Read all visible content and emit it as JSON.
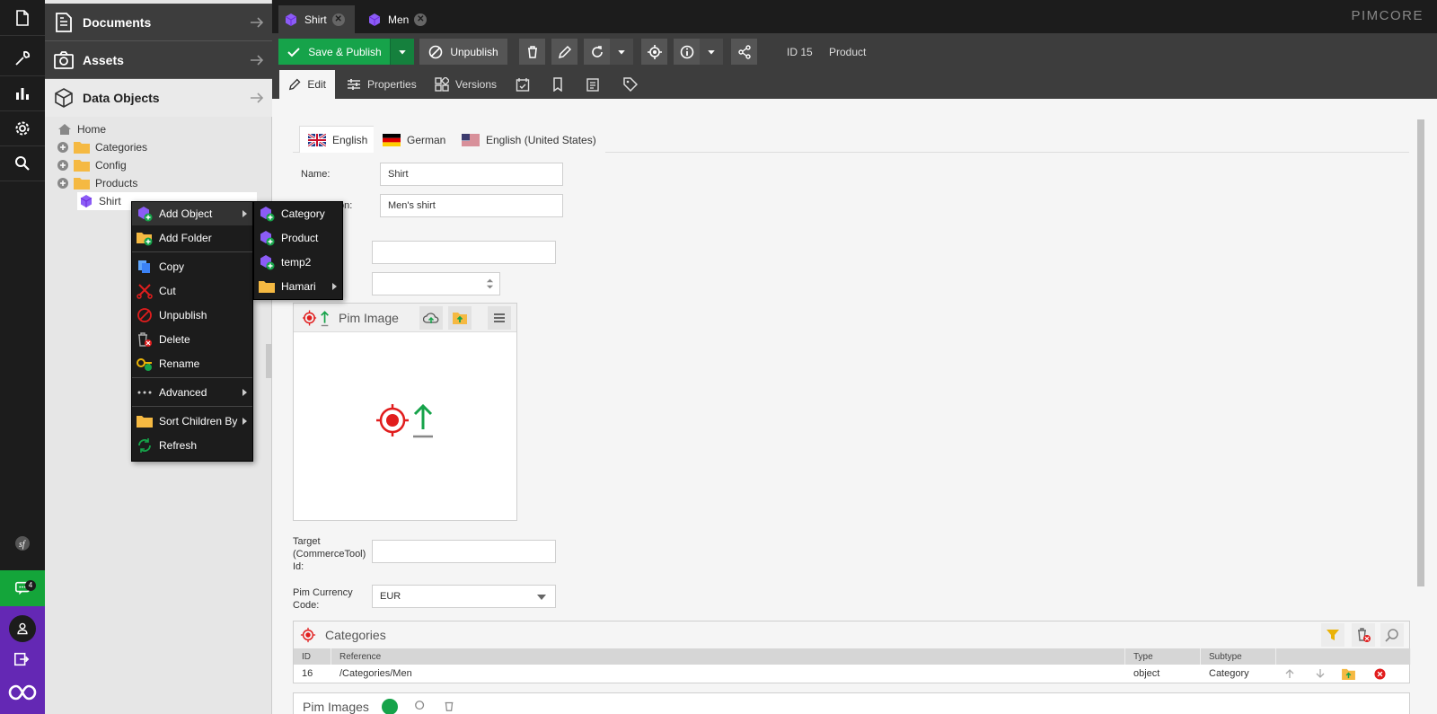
{
  "tree": {
    "sections": [
      {
        "label": "Documents"
      },
      {
        "label": "Assets"
      },
      {
        "label": "Data Objects"
      }
    ],
    "nodes": [
      "Home",
      "Categories",
      "Config",
      "Products",
      "Shirt"
    ]
  },
  "tabs": [
    {
      "label": "Shirt"
    },
    {
      "label": "Men"
    }
  ],
  "brand": "PIMCORE",
  "notification_count": "4",
  "toolbar": {
    "save_label": "Save & Publish",
    "unpublish_label": "Unpublish",
    "id_label": "ID 15",
    "class_label": "Product"
  },
  "subtabs": [
    "Edit",
    "Properties",
    "Versions"
  ],
  "languages": [
    "English",
    "German",
    "English (United States)"
  ],
  "form": {
    "name_label": "Name:",
    "name_value": "Shirt",
    "desc_label_partial": "on:",
    "desc_value": "Men's shirt",
    "target_label": "Target (CommerceTool) Id:",
    "currency_label": "Pim Currency Code:",
    "currency_value": "EUR"
  },
  "image_panel": {
    "title": "Pim Image"
  },
  "categories": {
    "title": "Categories",
    "columns": [
      "ID",
      "Reference",
      "Type",
      "Subtype"
    ],
    "rows": [
      {
        "id": "16",
        "reference": "/Categories/Men",
        "type": "object",
        "subtype": "Category"
      }
    ]
  },
  "pim_images_title": "Pim Images",
  "context_menu": {
    "items": [
      "Add Object",
      "Add Folder",
      "Copy",
      "Cut",
      "Unpublish",
      "Delete",
      "Rename",
      "Advanced",
      "Sort Children By",
      "Refresh"
    ],
    "submenu": [
      "Category",
      "Product",
      "temp2",
      "Hamari"
    ]
  },
  "colors": {
    "sidebar": "#1c1c1c",
    "publish_green": "#16a34a",
    "notification_green": "#14a53a",
    "profile_purple": "#6428b4"
  }
}
